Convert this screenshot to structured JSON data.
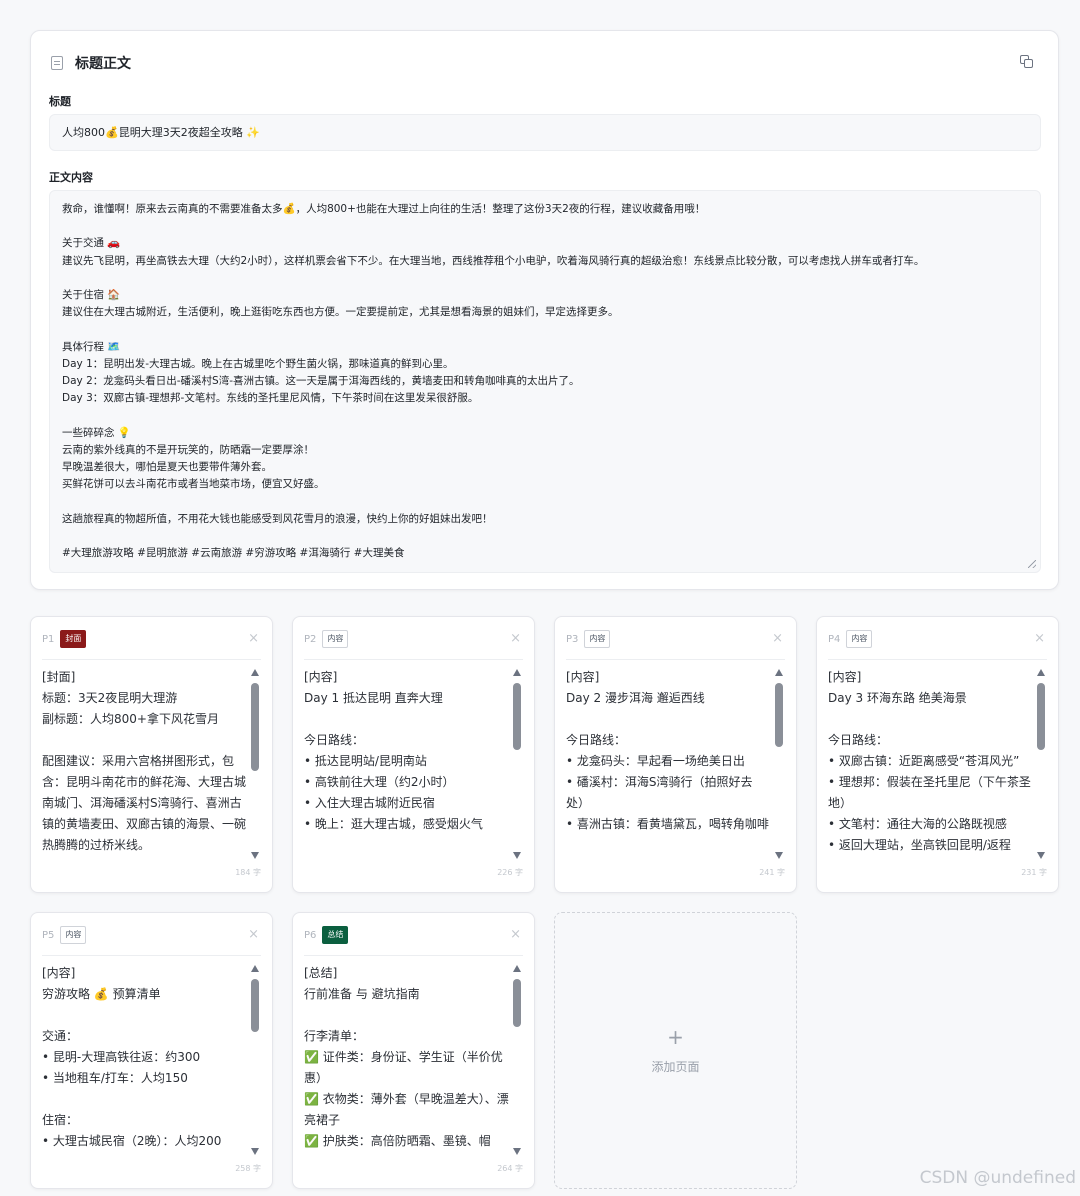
{
  "editor": {
    "title": "标题正文",
    "title_label": "标题",
    "title_value": "人均800💰昆明大理3天2夜超全攻略 ✨",
    "body_label": "正文内容",
    "body_value": "救命，谁懂啊！原来去云南真的不需要准备太多💰，人均800+也能在大理过上向往的生活！整理了这份3天2夜的行程，建议收藏备用哦！\n\n关于交通 🚗\n建议先飞昆明，再坐高铁去大理（大约2小时），这样机票会省下不少。在大理当地，西线推荐租个小电驴，吹着海风骑行真的超级治愈！东线景点比较分散，可以考虑找人拼车或者打车。\n\n关于住宿 🏠\n建议住在大理古城附近，生活便利，晚上逛街吃东西也方便。一定要提前定，尤其是想看海景的姐妹们，早定选择更多。\n\n具体行程 🗺️\nDay 1：昆明出发-大理古城。晚上在古城里吃个野生菌火锅，那味道真的鲜到心里。\nDay 2：龙龛码头看日出-磻溪村S湾-喜洲古镇。这一天是属于洱海西线的，黄墙麦田和转角咖啡真的太出片了。\nDay 3：双廊古镇-理想邦-文笔村。东线的圣托里尼风情，下午茶时间在这里发呆很舒服。\n\n一些碎碎念 💡\n云南的紫外线真的不是开玩笑的，防晒霜一定要厚涂！\n早晚温差很大，哪怕是夏天也要带件薄外套。\n买鲜花饼可以去斗南花市或者当地菜市场，便宜又好盛。\n\n这趟旅程真的物超所值，不用花大钱也能感受到风花雪月的浪漫，快约上你的好姐妹出发吧！\n\n#大理旅游攻略 #昆明旅游 #云南旅游 #穷游攻略 #洱海骑行 #大理美食"
  },
  "pages": [
    {
      "num": "P1",
      "badge": "封面",
      "badge_type": "cover",
      "close": "×",
      "content": "[封面]\n标题：3天2夜昆明大理游\n副标题：人均800+拿下风花雪月\n\n配图建议：采用六宫格拼图形式，包含：昆明斗南花市的鲜花海、大理古城南城门、洱海磻溪村S湾骑行、喜洲古镇的黄墙麦田、双廊古镇的海景、一碗热腾腾的过桥米线。",
      "count": "184 字",
      "scroll_thumb": 0.55
    },
    {
      "num": "P2",
      "badge": "内容",
      "badge_type": "content",
      "close": "×",
      "content": "[内容]\nDay 1 抵达昆明 直奔大理\n\n今日路线：\n• 抵达昆明站/昆明南站\n• 高铁前往大理（约2小时）\n• 入住大理古城附近民宿\n• 晚上：逛大理古城，感受烟火气",
      "count": "226 字",
      "scroll_thumb": 0.42
    },
    {
      "num": "P3",
      "badge": "内容",
      "badge_type": "content",
      "close": "×",
      "content": "[内容]\nDay 2 漫步洱海 邂逅西线\n\n今日路线：\n• 龙龛码头：早起看一场绝美日出\n• 磻溪村：洱海S湾骑行（拍照好去处）\n• 喜洲古镇：看黄墙黛瓦，喝转角咖啡",
      "count": "241 字",
      "scroll_thumb": 0.4
    },
    {
      "num": "P4",
      "badge": "内容",
      "badge_type": "content",
      "close": "×",
      "content": "[内容]\nDay 3 环海东路 绝美海景\n\n今日路线：\n• 双廊古镇：近距离感受“苍洱风光”\n• 理想邦：假装在圣托里尼（下午茶圣地）\n• 文笔村：通往大海的公路既视感\n• 返回大理站，坐高铁回昆明/返程",
      "count": "231 字",
      "scroll_thumb": 0.42
    },
    {
      "num": "P5",
      "badge": "内容",
      "badge_type": "content",
      "close": "×",
      "content": "[内容]\n穷游攻略 💰 预算清单\n\n交通：\n• 昆明-大理高铁往返：约300\n• 当地租车/打车：人均150\n\n住宿：\n• 大理古城民宿（2晚）：人均200",
      "count": "258 字",
      "scroll_thumb": 0.33
    },
    {
      "num": "P6",
      "badge": "总结",
      "badge_type": "summary",
      "close": "×",
      "content": "[总结]\n行前准备 与 避坑指南\n\n行李清单：\n✅ 证件类：身份证、学生证（半价优惠）\n✅ 衣物类：薄外套（早晚温差大）、漂亮裙子\n✅ 护肤类：高倍防晒霜、墨镜、帽",
      "count": "264 字",
      "scroll_thumb": 0.3
    }
  ],
  "add_page": {
    "plus": "+",
    "label": "添加页面"
  },
  "watermark": "CSDN @undefined"
}
